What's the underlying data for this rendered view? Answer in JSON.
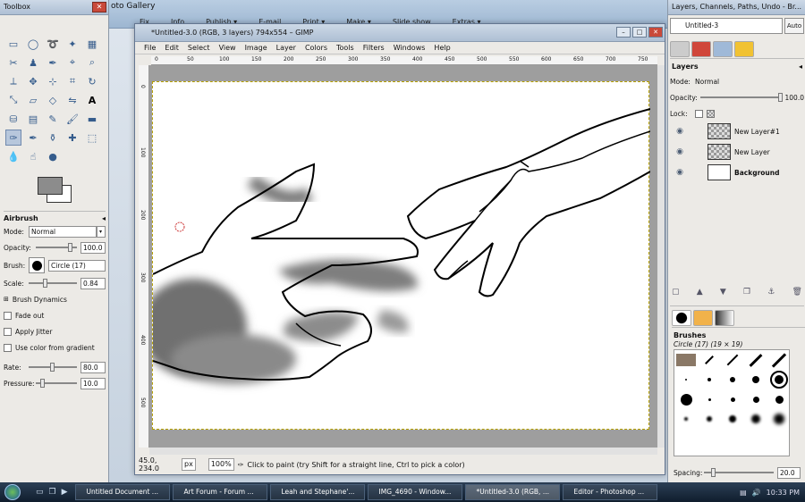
{
  "gallery": {
    "title": "oto Gallery",
    "menu": [
      "Fix",
      "Info",
      "Publish ▾",
      "E-mail",
      "Print ▾",
      "Make ▾",
      "Slide show",
      "Extras ▾"
    ]
  },
  "toolbox": {
    "title": "Toolbox",
    "options": {
      "title": "Airbrush",
      "mode_label": "Mode:",
      "mode_value": "Normal",
      "opacity_label": "Opacity:",
      "opacity_value": "100.0",
      "brush_label": "Brush:",
      "brush_value": "Circle (17)",
      "scale_label": "Scale:",
      "scale_value": "0.84",
      "dynamics_label": "Brush Dynamics",
      "fade_label": "Fade out",
      "jitter_label": "Apply Jitter",
      "gradient_label": "Use color from gradient",
      "rate_label": "Rate:",
      "rate_value": "80.0",
      "pressure_label": "Pressure:",
      "pressure_value": "10.0"
    }
  },
  "main": {
    "title": "*Untitled-3.0 (RGB, 3 layers) 794x554 – GIMP",
    "menu": [
      "File",
      "Edit",
      "Select",
      "View",
      "Image",
      "Layer",
      "Colors",
      "Tools",
      "Filters",
      "Windows",
      "Help"
    ],
    "ruler_top": [
      "0",
      "50",
      "100",
      "150",
      "200",
      "250",
      "300",
      "350",
      "400",
      "450",
      "500",
      "550",
      "600",
      "650",
      "700",
      "750"
    ],
    "ruler_left": [
      "0",
      "100",
      "200",
      "300",
      "400",
      "500"
    ],
    "status": {
      "coords": "45.0, 234.0",
      "unit": "px",
      "zoom": "100%",
      "message": "Click to paint (try Shift for a straight line, Ctrl to pick a color)"
    }
  },
  "dock": {
    "title": "Layers, Channels, Paths, Undo - Br...",
    "image_select": "Untitled-3",
    "auto_label": "Auto",
    "layers": {
      "title": "Layers",
      "mode_label": "Mode:",
      "mode_value": "Normal",
      "opacity_label": "Opacity:",
      "opacity_value": "100.0",
      "lock_label": "Lock:",
      "items": [
        {
          "name": "New Layer#1"
        },
        {
          "name": "New Layer"
        },
        {
          "name": "Background"
        }
      ]
    },
    "brushes": {
      "title": "Brushes",
      "current": "Circle (17) (19 × 19)",
      "spacing_label": "Spacing:",
      "spacing_value": "20.0"
    }
  },
  "taskbar": {
    "tasks": [
      "Untitled Document ...",
      "Art Forum - Forum ...",
      "Leah and Stephane'...",
      "IMG_4690 - Window...",
      "*Untitled-3.0 (RGB, ...",
      "Editor - Photoshop ..."
    ],
    "clock": "10:33 PM"
  }
}
